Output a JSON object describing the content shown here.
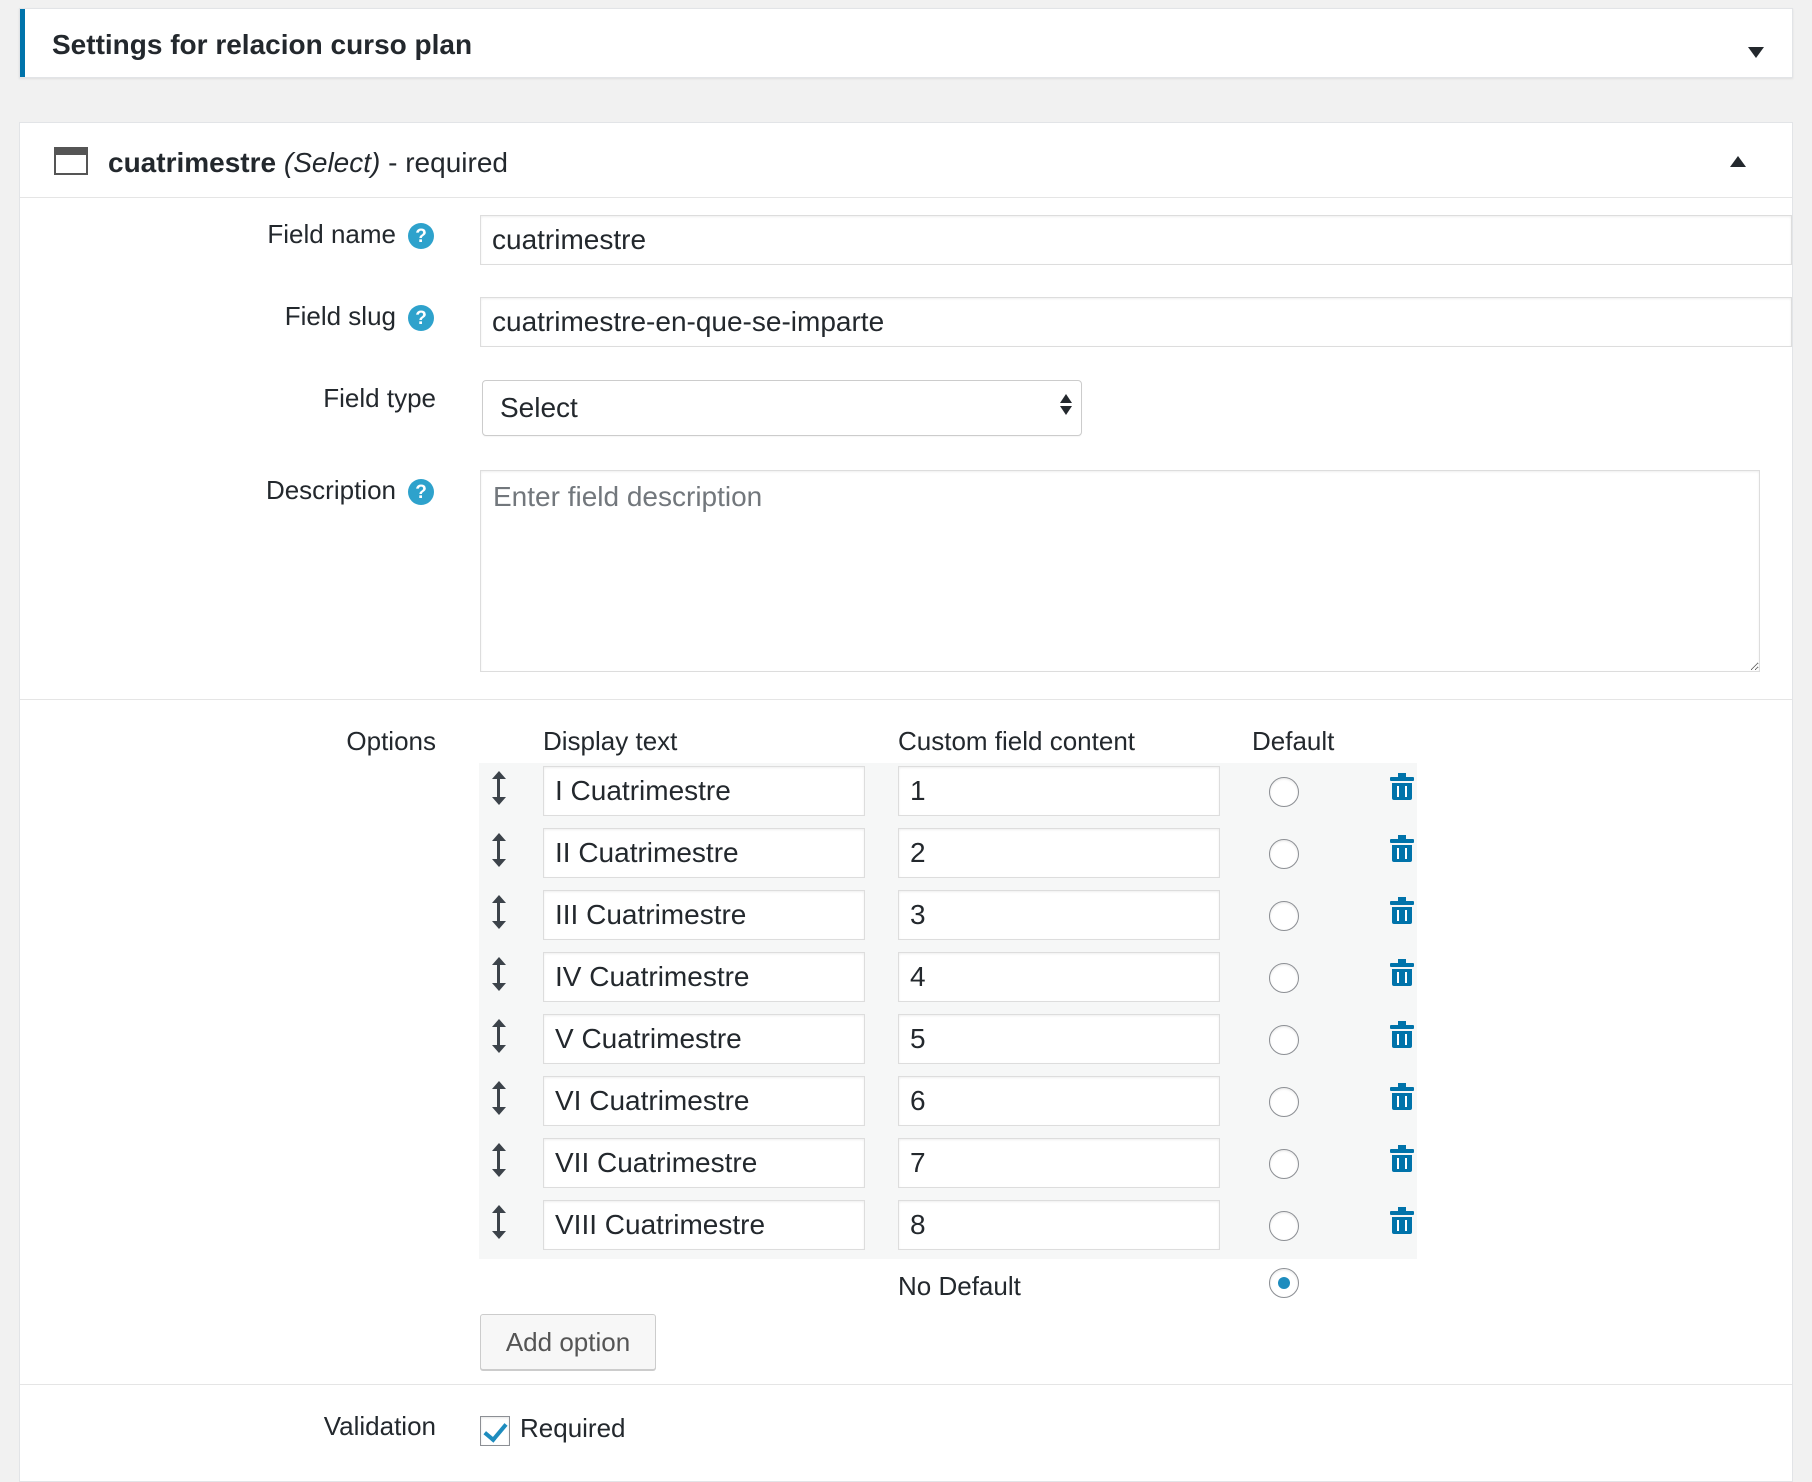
{
  "settings_panel": {
    "title": "Settings for relacion curso plan"
  },
  "field": {
    "name_bold": "cuatrimestre",
    "type_italic": "(Select)",
    "required_suffix": "- required"
  },
  "form": {
    "field_name_label": "Field name",
    "field_name_value": "cuatrimestre",
    "field_slug_label": "Field slug",
    "field_slug_value": "cuatrimestre-en-que-se-imparte",
    "field_type_label": "Field type",
    "field_type_value": "Select",
    "description_label": "Description",
    "description_placeholder": "Enter field description",
    "help_glyph": "?"
  },
  "options": {
    "label": "Options",
    "col_display": "Display text",
    "col_content": "Custom field content",
    "col_default": "Default",
    "rows": [
      {
        "display": "I Cuatrimestre",
        "content": "1"
      },
      {
        "display": "II Cuatrimestre",
        "content": "2"
      },
      {
        "display": "III Cuatrimestre",
        "content": "3"
      },
      {
        "display": "IV Cuatrimestre",
        "content": "4"
      },
      {
        "display": "V Cuatrimestre",
        "content": "5"
      },
      {
        "display": "VI Cuatrimestre",
        "content": "6"
      },
      {
        "display": "VII Cuatrimestre",
        "content": "7"
      },
      {
        "display": "VIII Cuatrimestre",
        "content": "8"
      }
    ],
    "no_default_label": "No Default",
    "no_default_selected": true,
    "add_option_label": "Add option"
  },
  "validation": {
    "label": "Validation",
    "required_label": "Required",
    "required_checked": true
  },
  "colors": {
    "accent": "#0073aa",
    "help": "#2ea2cc",
    "radio_dot": "#1e8cbe"
  },
  "icons": {
    "collapse": "triangle-down-icon",
    "expand": "triangle-up-icon",
    "field": "window-icon",
    "help": "question-circle-icon",
    "drag": "vertical-resize-icon",
    "delete": "trash-icon"
  }
}
